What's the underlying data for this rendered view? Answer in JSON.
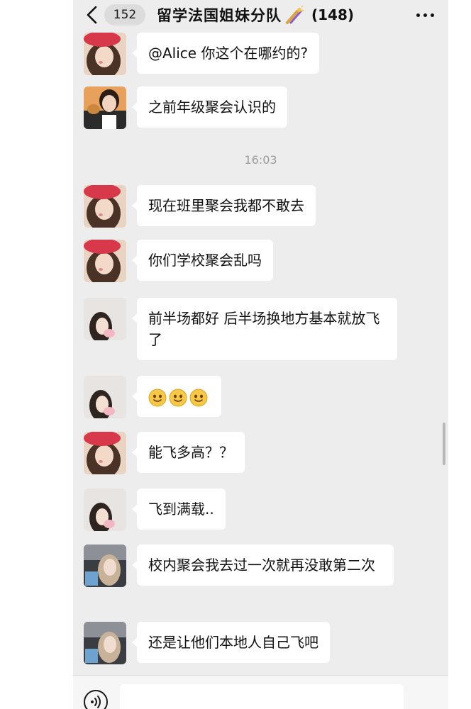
{
  "header": {
    "back_icon": "chevron-left-icon",
    "unread_count": "152",
    "title": "留学法国姐妹分队",
    "title_emoji": "sparkler-emoji-icon",
    "member_count": "(148)",
    "more_icon": "more-dots-icon"
  },
  "messages": [
    {
      "avatar": "avatar-red-hat-girl",
      "text": "@Alice 你这个在哪约的?"
    },
    {
      "avatar": "avatar-girl-eating",
      "text": "之前年级聚会认识的"
    },
    {
      "avatar": "avatar-red-hat-girl",
      "text": "现在班里聚会我都不敢去"
    },
    {
      "avatar": "avatar-red-hat-girl",
      "text": "你们学校聚会乱吗"
    },
    {
      "avatar": "avatar-girl-pink-hand",
      "text": "前半场都好 后半场换地方基本就放飞了"
    },
    {
      "avatar": "avatar-girl-pink-hand",
      "emojis": [
        "smiley-face-icon",
        "smiley-face-icon",
        "smiley-face-icon"
      ]
    },
    {
      "avatar": "avatar-red-hat-girl",
      "text": "能飞多高？？"
    },
    {
      "avatar": "avatar-girl-pink-hand",
      "text": "飞到满载.."
    },
    {
      "avatar": "avatar-girl-car-selfie",
      "text": "校内聚会我去过一次就再没敢第二次"
    },
    {
      "avatar": "avatar-girl-car-selfie",
      "text": "还是让他们本地人自己飞吧"
    }
  ],
  "timestamp": "16:03",
  "input_bar": {
    "voice_icon": "voice-icon",
    "input_value": ""
  },
  "colors": {
    "chat_background": "#ededed",
    "bubble": "#ffffff",
    "timestamp_text": "#9a9a9a"
  }
}
